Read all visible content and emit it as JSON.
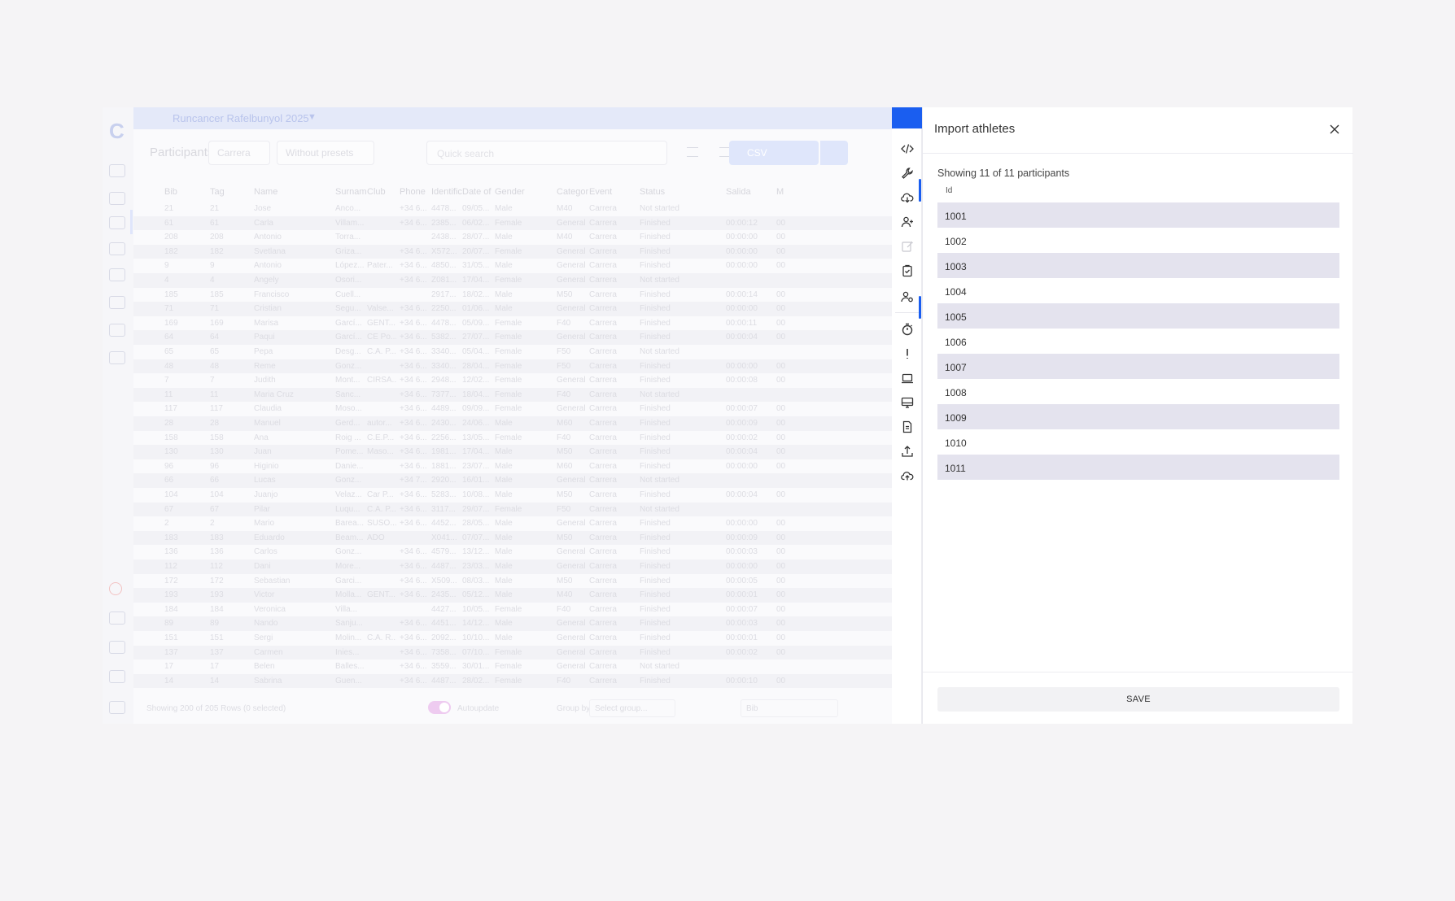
{
  "background_app": {
    "event_title": "Runcancer Rafelbunyol 2025",
    "toolbar": {
      "title": "Participants",
      "event_select": "Carrera",
      "preset_select": "Without presets",
      "search_placeholder": "Quick search",
      "csv_label": "CSV"
    },
    "table_headers": [
      "Bib",
      "Tag",
      "Name",
      "Surnam",
      "Club",
      "Phone",
      "Identific",
      "Date of",
      "Gender",
      "Categor",
      "Event",
      "Status",
      "Salida",
      "M"
    ],
    "rows": [
      [
        "21",
        "21",
        "Jose",
        "Anco...",
        "",
        "+34 6...",
        "4478...",
        "09/05...",
        "Male",
        "M40",
        "Carrera",
        "Not started",
        "",
        ""
      ],
      [
        "61",
        "61",
        "Carla",
        "Villam...",
        "",
        "+34 6...",
        "2385...",
        "06/02...",
        "Female",
        "General",
        "Carrera",
        "Finished",
        "00:00:12",
        "00"
      ],
      [
        "208",
        "208",
        "Antonio",
        "Torra...",
        "",
        "",
        "2438...",
        "28/07...",
        "Male",
        "M40",
        "Carrera",
        "Finished",
        "00:00:00",
        "00"
      ],
      [
        "182",
        "182",
        "Svetlana",
        "Griza...",
        "",
        "+34 6...",
        "X572...",
        "20/07...",
        "Female",
        "General",
        "Carrera",
        "Finished",
        "00:00:00",
        "00"
      ],
      [
        "9",
        "9",
        "Antonio",
        "López...",
        "Pater...",
        "+34 6...",
        "4850...",
        "31/05...",
        "Male",
        "General",
        "Carrera",
        "Finished",
        "00:00:00",
        "00"
      ],
      [
        "4",
        "4",
        "Angely",
        "Osori...",
        "",
        "+34 6...",
        "Z081...",
        "17/04...",
        "Female",
        "General",
        "Carrera",
        "Not started",
        "",
        ""
      ],
      [
        "185",
        "185",
        "Francisco",
        "Cuell...",
        "",
        "",
        "2917...",
        "18/02...",
        "Male",
        "M50",
        "Carrera",
        "Finished",
        "00:00:14",
        "00"
      ],
      [
        "71",
        "71",
        "Cristian",
        "Segu...",
        "Valse...",
        "+34 6...",
        "2250...",
        "01/06...",
        "Male",
        "General",
        "Carrera",
        "Finished",
        "00:00:00",
        "00"
      ],
      [
        "169",
        "169",
        "Marisa",
        "Garcí...",
        "GENT...",
        "+34 6...",
        "4478...",
        "05/09...",
        "Female",
        "F40",
        "Carrera",
        "Finished",
        "00:00:11",
        "00"
      ],
      [
        "64",
        "64",
        "Paqui",
        "Garcí...",
        "CE Po...",
        "+34 6...",
        "5382...",
        "27/07...",
        "Female",
        "General",
        "Carrera",
        "Finished",
        "00:00:04",
        "00"
      ],
      [
        "65",
        "65",
        "Pepa",
        "Desg...",
        "C.A. P...",
        "+34 6...",
        "3340...",
        "05/04...",
        "Female",
        "F50",
        "Carrera",
        "Not started",
        "",
        ""
      ],
      [
        "48",
        "48",
        "Reme",
        "Gonz...",
        "",
        "+34 6...",
        "3340...",
        "28/04...",
        "Female",
        "F50",
        "Carrera",
        "Finished",
        "00:00:00",
        "00"
      ],
      [
        "7",
        "7",
        "Judith",
        "Mont...",
        "CIRSA...",
        "+34 6...",
        "2948...",
        "12/02...",
        "Female",
        "General",
        "Carrera",
        "Finished",
        "00:00:08",
        "00"
      ],
      [
        "11",
        "11",
        "Maria Cruz",
        "Sanc...",
        "",
        "+34 6...",
        "7377...",
        "18/04...",
        "Female",
        "F40",
        "Carrera",
        "Not started",
        "",
        ""
      ],
      [
        "117",
        "117",
        "Claudia",
        "Moso...",
        "",
        "+34 6...",
        "4489...",
        "09/09...",
        "Female",
        "General",
        "Carrera",
        "Finished",
        "00:00:07",
        "00"
      ],
      [
        "28",
        "28",
        "Manuel",
        "Gerd...",
        "autor...",
        "+34 6...",
        "2430...",
        "24/06...",
        "Male",
        "M60",
        "Carrera",
        "Finished",
        "00:00:09",
        "00"
      ],
      [
        "158",
        "158",
        "Ana",
        "Roig ...",
        "C.E.P...",
        "+34 6...",
        "2256...",
        "13/05...",
        "Female",
        "F40",
        "Carrera",
        "Finished",
        "00:00:02",
        "00"
      ],
      [
        "130",
        "130",
        "Juan",
        "Pome...",
        "Maso...",
        "+34 6...",
        "1981...",
        "17/04...",
        "Male",
        "M50",
        "Carrera",
        "Finished",
        "00:00:04",
        "00"
      ],
      [
        "96",
        "96",
        "Higinio",
        "Danie...",
        "",
        "+34 6...",
        "1881...",
        "23/07...",
        "Male",
        "M60",
        "Carrera",
        "Finished",
        "00:00:00",
        "00"
      ],
      [
        "66",
        "66",
        "Lucas",
        "Gonz...",
        "",
        "+34 7...",
        "2920...",
        "16/01...",
        "Male",
        "General",
        "Carrera",
        "Not started",
        "",
        ""
      ],
      [
        "104",
        "104",
        "Juanjo",
        "Velaz...",
        "Car P...",
        "+34 6...",
        "5283...",
        "10/08...",
        "Male",
        "M50",
        "Carrera",
        "Finished",
        "00:00:04",
        "00"
      ],
      [
        "67",
        "67",
        "Pilar",
        "Luqu...",
        "C.A. P...",
        "+34 6...",
        "3117...",
        "29/07...",
        "Female",
        "F50",
        "Carrera",
        "Not started",
        "",
        ""
      ],
      [
        "2",
        "2",
        "Mario",
        "Barea...",
        "SUSO...",
        "+34 6...",
        "4452...",
        "28/05...",
        "Male",
        "General",
        "Carrera",
        "Finished",
        "00:00:00",
        "00"
      ],
      [
        "183",
        "183",
        "Eduardo",
        "Beam...",
        "ADO",
        "",
        "X041...",
        "07/07...",
        "Male",
        "M50",
        "Carrera",
        "Finished",
        "00:00:09",
        "00"
      ],
      [
        "136",
        "136",
        "Carlos",
        "Gonz...",
        "",
        "+34 6...",
        "4579...",
        "13/12...",
        "Male",
        "General",
        "Carrera",
        "Finished",
        "00:00:03",
        "00"
      ],
      [
        "112",
        "112",
        "Dani",
        "More...",
        "",
        "+34 6...",
        "4487...",
        "23/03...",
        "Male",
        "General",
        "Carrera",
        "Finished",
        "00:00:00",
        "00"
      ],
      [
        "172",
        "172",
        "Sebastian",
        "Garci...",
        "",
        "+34 6...",
        "X509...",
        "08/03...",
        "Male",
        "M50",
        "Carrera",
        "Finished",
        "00:00:05",
        "00"
      ],
      [
        "193",
        "193",
        "Victor",
        "Molla...",
        "GENT...",
        "+34 6...",
        "2435...",
        "05/12...",
        "Male",
        "M40",
        "Carrera",
        "Finished",
        "00:00:01",
        "00"
      ],
      [
        "184",
        "184",
        "Veronica",
        "Villa...",
        "",
        "",
        "4427...",
        "10/05...",
        "Female",
        "F40",
        "Carrera",
        "Finished",
        "00:00:07",
        "00"
      ],
      [
        "89",
        "89",
        "Nando",
        "Sanju...",
        "",
        "+34 6...",
        "4451...",
        "14/12...",
        "Male",
        "General",
        "Carrera",
        "Finished",
        "00:00:03",
        "00"
      ],
      [
        "151",
        "151",
        "Sergi",
        "Molin...",
        "C.A. R...",
        "+34 6...",
        "2092...",
        "10/10...",
        "Male",
        "General",
        "Carrera",
        "Finished",
        "00:00:01",
        "00"
      ],
      [
        "137",
        "137",
        "Carmen",
        "Inies...",
        "",
        "+34 6...",
        "7358...",
        "07/10...",
        "Female",
        "General",
        "Carrera",
        "Finished",
        "00:00:02",
        "00"
      ],
      [
        "17",
        "17",
        "Belen",
        "Balles...",
        "",
        "+34 6...",
        "3559...",
        "30/01...",
        "Female",
        "General",
        "Carrera",
        "Not started",
        "",
        ""
      ],
      [
        "14",
        "14",
        "Sabrina",
        "Guen...",
        "",
        "+34 6...",
        "4487...",
        "28/02...",
        "Female",
        "F40",
        "Carrera",
        "Finished",
        "00:00:10",
        "00"
      ]
    ],
    "footer": {
      "showing_text": "Showing 200 of 205 Rows (0 selected)",
      "autoupdate_label": "Autoupdate",
      "group_label": "Group by",
      "group_placeholder": "Select group...",
      "input_value": "Bib"
    }
  },
  "rail": {
    "icons": [
      "code-icon",
      "wrench-icon",
      "cloud-download-icon",
      "user-plus-icon",
      "edit-icon",
      "clipboard-check-icon",
      "user-gear-icon",
      "stopwatch-icon",
      "exclamation-icon",
      "laptop-icon",
      "monitor-icon",
      "document-icon",
      "upload-icon",
      "cloud-upload-icon"
    ],
    "accent_color": "#1a5ef0"
  },
  "modal": {
    "title": "Import athletes",
    "count_text": "Showing 11 of 11 participants",
    "column_header": "Id",
    "ids": [
      "1001",
      "1002",
      "1003",
      "1004",
      "1005",
      "1006",
      "1007",
      "1008",
      "1009",
      "1010",
      "1011"
    ],
    "save_label": "SAVE"
  }
}
